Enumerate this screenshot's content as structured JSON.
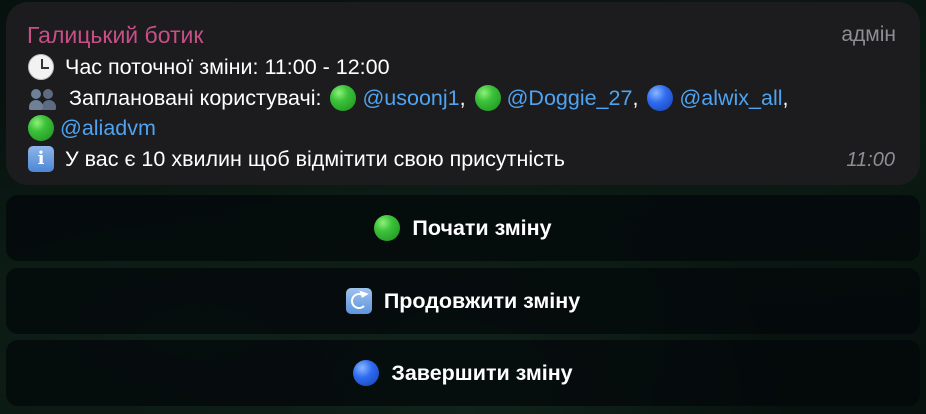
{
  "message": {
    "sender": "Галицький ботик",
    "role": "адмін",
    "shift_label": "Час поточної зміни: 11:00 - 12:00",
    "users_label": "Заплановані користувачі:",
    "users": [
      {
        "handle": "@usoonj1",
        "status": "green",
        "sep": ","
      },
      {
        "handle": "@Doggie_27",
        "status": "green",
        "sep": ","
      },
      {
        "handle": "@alwix_all",
        "status": "blue",
        "sep": ","
      },
      {
        "handle": "@aliadvm",
        "status": "green",
        "sep": ""
      }
    ],
    "notice": "У вас є 10 хвилин щоб відмітити свою присутність",
    "time": "11:00"
  },
  "keyboard": {
    "start_label": "Почати зміну",
    "extend_label": "Продовжити зміну",
    "finish_label": "Завершити зміну"
  },
  "colors": {
    "sender": "#c74e88",
    "mention": "#4fa3f0",
    "bubble": "#1c1c1e"
  },
  "icons": {
    "shift_time": "clock-icon",
    "users": "users-icon",
    "notice": "info-icon",
    "start": "green-circle-icon",
    "extend": "refresh-icon",
    "finish": "blue-circle-icon"
  }
}
